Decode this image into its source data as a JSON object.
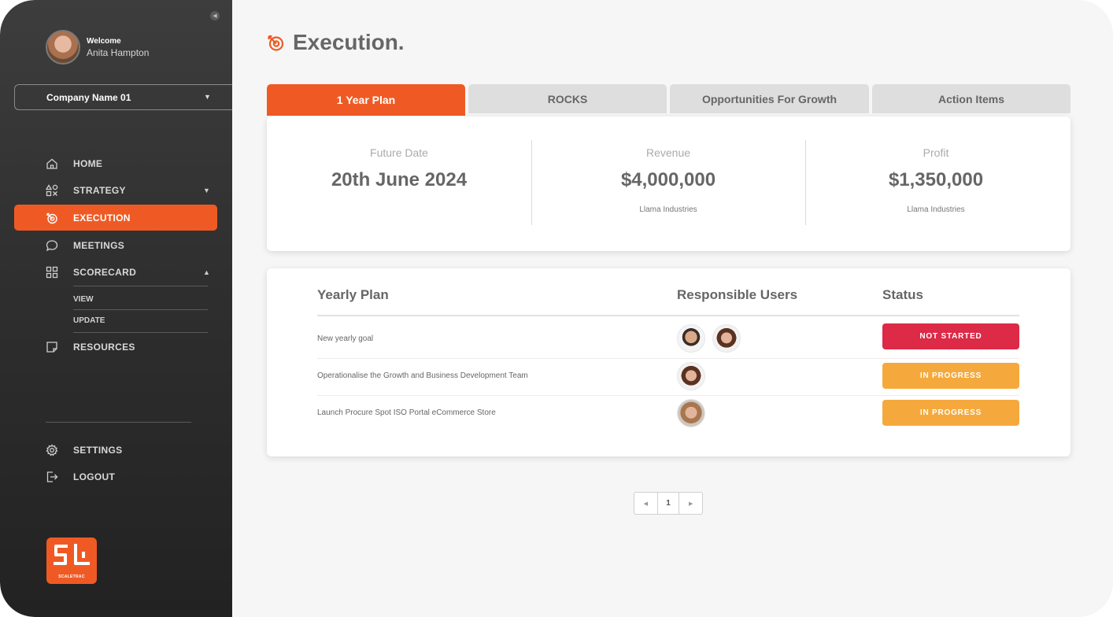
{
  "user": {
    "welcome": "Welcome",
    "name": "Anita Hampton"
  },
  "company": {
    "selected": "Company Name 01"
  },
  "nav": {
    "home": "HOME",
    "strategy": "STRATEGY",
    "execution": "EXECUTION",
    "meetings": "MEETINGS",
    "scorecard": "SCORECARD",
    "scorecard_view": "VIEW",
    "scorecard_update": "UPDATE",
    "resources": "RESOURCES",
    "settings": "SETTINGS",
    "logout": "LOGOUT"
  },
  "logo": {
    "text": "SCALETRAC"
  },
  "page": {
    "title": "Execution."
  },
  "tabs": [
    "1 Year Plan",
    "ROCKS",
    "Opportunities For Growth",
    "Action Items"
  ],
  "kpis": [
    {
      "label": "Future Date",
      "value": "20th June 2024",
      "sub": ""
    },
    {
      "label": "Revenue",
      "value": "$4,000,000",
      "sub": "Llama Industries"
    },
    {
      "label": "Profit",
      "value": "$1,350,000",
      "sub": "Llama Industries"
    }
  ],
  "table": {
    "headers": {
      "plan": "Yearly Plan",
      "users": "Responsible Users",
      "status": "Status"
    },
    "rows": [
      {
        "plan": "New yearly goal",
        "status": "NOT STARTED"
      },
      {
        "plan": "Operationalise the Growth and Business Development Team",
        "status": "IN PROGRESS"
      },
      {
        "plan": "Launch Procure Spot ISO Portal eCommerce Store",
        "status": "IN PROGRESS"
      }
    ]
  },
  "pagination": {
    "current": "1"
  },
  "colors": {
    "accent": "#ef5a24",
    "not_started": "#dc2a47",
    "in_progress": "#f5a93d"
  }
}
